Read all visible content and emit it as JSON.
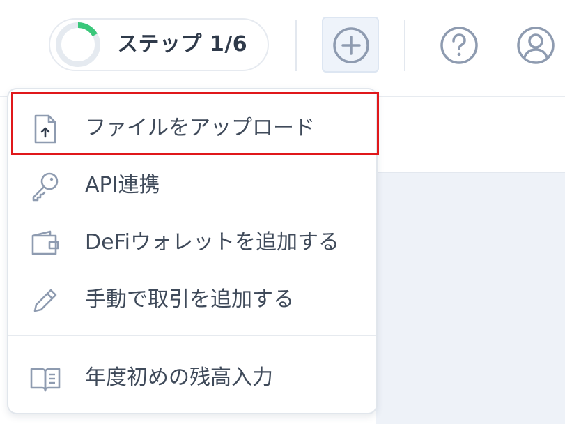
{
  "header": {
    "step_label": "ステップ 1/6",
    "step_progress": 0.1667,
    "progress_color": "#3ac77a",
    "icons": {
      "add": "plus-circle-icon",
      "help": "question-circle-icon",
      "account": "user-circle-icon"
    }
  },
  "menu": {
    "items": [
      {
        "label": "ファイルをアップロード",
        "icon": "file-upload-icon",
        "highlighted": true
      },
      {
        "label": "API連携",
        "icon": "key-icon"
      },
      {
        "label": "DeFiウォレットを追加する",
        "icon": "wallet-icon"
      },
      {
        "label": "手動で取引を追加する",
        "icon": "pencil-icon"
      },
      {
        "label": "年度初めの残高入力",
        "icon": "book-icon"
      }
    ]
  },
  "colors": {
    "highlight_border": "#e0181b",
    "icon_stroke": "#8e9bb0"
  }
}
